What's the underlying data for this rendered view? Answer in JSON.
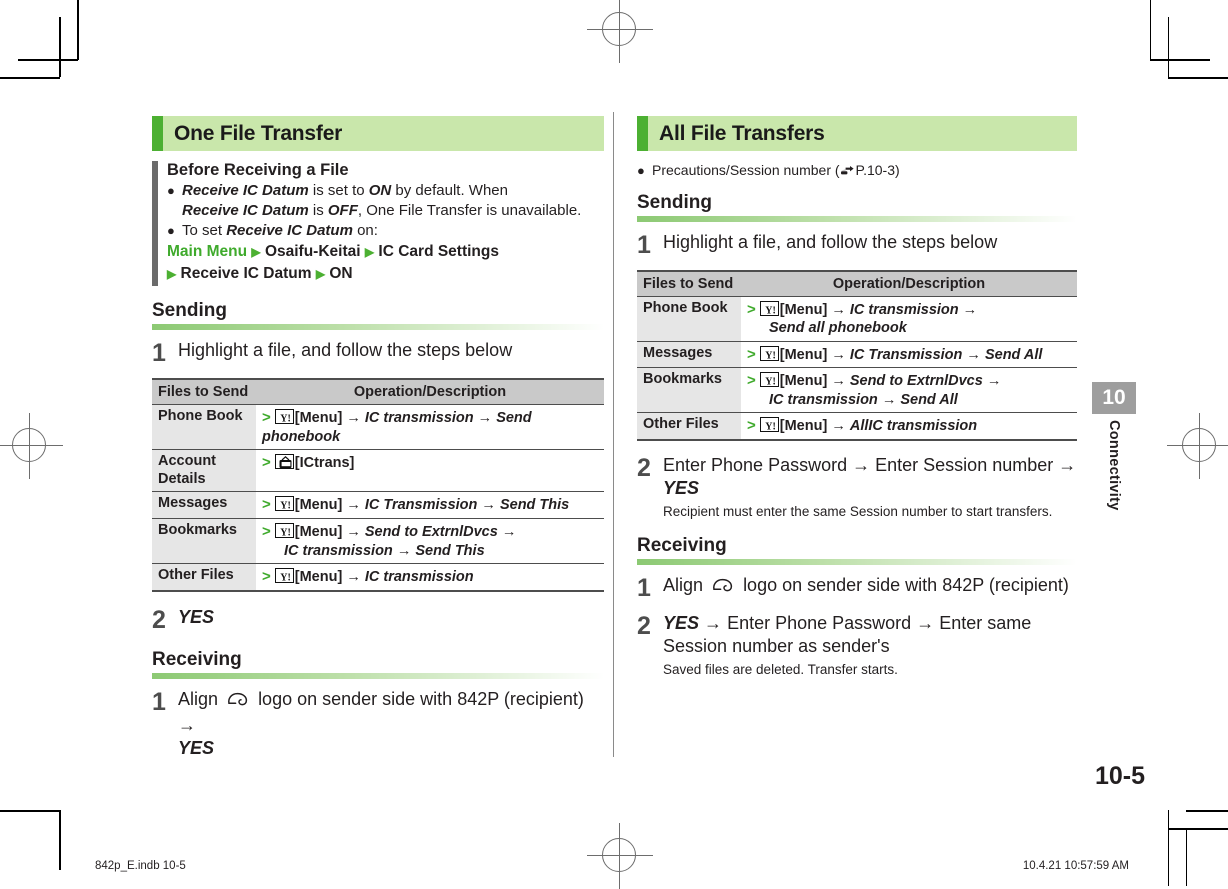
{
  "document": {
    "folio": "10-5",
    "chapter_tab": {
      "number": "10",
      "label": "Connectivity"
    },
    "footer": {
      "left": "842p_E.indb   10-5",
      "right": "10.4.21   10:57:59 AM"
    },
    "colors": {
      "accent_green": "#4cb032",
      "banner_bg": "#c9e7ab",
      "table_header_bg": "#c9c9c9",
      "row_key_bg": "#e6e6e6",
      "gray_rule": "#6b6b6b"
    }
  },
  "left_column": {
    "banner_title": "One File Transfer",
    "note": {
      "heading": "Before Receiving a File",
      "bullet1_a": "Receive IC Datum",
      "bullet1_b": " is set to ",
      "bullet1_c": "ON",
      "bullet1_d": " by default. When",
      "bullet1_line2_a": "Receive IC Datum",
      "bullet1_line2_b": " is ",
      "bullet1_line2_c": "OFF",
      "bullet1_line2_d": ", One File Transfer is unavailable.",
      "bullet2_a": "To set ",
      "bullet2_b": "Receive IC Datum",
      "bullet2_c": " on:",
      "path_main_menu": "Main Menu",
      "path_item1": "Osaifu-Keitai",
      "path_item2": "IC Card Settings",
      "path_item3": "Receive IC Datum",
      "path_item4": "ON"
    },
    "sending": {
      "heading": "Sending",
      "step1_num": "1",
      "step1_text": "Highlight a file, and follow the steps below",
      "step2_num": "2",
      "step2_text": "YES"
    },
    "table": {
      "header": {
        "col1": "Files to Send",
        "col2": "Operation/Description"
      },
      "rows": [
        {
          "key": "Phone Book",
          "icon": "yahoo-softkey-icon",
          "label": "[Menu]",
          "ops": [
            "IC transmission",
            "Send phonebook"
          ],
          "line2": ""
        },
        {
          "key": "Account Details",
          "icon": "tv-softkey-icon",
          "label": "[ICtrans]",
          "ops": [],
          "line2": ""
        },
        {
          "key": "Messages",
          "icon": "yahoo-softkey-icon",
          "label": "[Menu]",
          "ops": [
            "IC Transmission",
            "Send This"
          ],
          "line2": ""
        },
        {
          "key": "Bookmarks",
          "icon": "yahoo-softkey-icon",
          "label": "[Menu]",
          "ops": [
            "Send to ExtrnlDvcs"
          ],
          "line2_ops": [
            "IC transmission",
            "Send This"
          ]
        },
        {
          "key": "Other Files",
          "icon": "yahoo-softkey-icon",
          "label": "[Menu]",
          "ops": [
            "IC transmission"
          ],
          "line2": ""
        }
      ]
    },
    "receiving": {
      "heading": "Receiving",
      "step1_num": "1",
      "step1_a": "Align",
      "step1_b": "logo on sender side with 842P (recipient)",
      "step1_c": "YES"
    }
  },
  "right_column": {
    "banner_title": "All File Transfers",
    "precaution": {
      "text": "Precautions/Session number (",
      "ref": "P.10-3",
      "close": ")"
    },
    "sending": {
      "heading": "Sending",
      "step1_num": "1",
      "step1_text": "Highlight a file, and follow the steps below",
      "step2_num": "2",
      "step2_part1": "Enter Phone Password",
      "step2_part2": "Enter Session number",
      "step2_part3": "YES",
      "step2_sub": "Recipient must enter the same Session number to start transfers."
    },
    "table": {
      "header": {
        "col1": "Files to Send",
        "col2": "Operation/Description"
      },
      "rows": [
        {
          "key": "Phone Book",
          "icon": "yahoo-softkey-icon",
          "label": "[Menu]",
          "ops": [
            "IC transmission"
          ],
          "line2_ops": [
            "Send all phonebook"
          ]
        },
        {
          "key": "Messages",
          "icon": "yahoo-softkey-icon",
          "label": "[Menu]",
          "ops": [
            "IC Transmission",
            "Send All"
          ],
          "line2_ops": []
        },
        {
          "key": "Bookmarks",
          "icon": "yahoo-softkey-icon",
          "label": "[Menu]",
          "ops": [
            "Send to ExtrnlDvcs"
          ],
          "line2_ops": [
            "IC transmission",
            "Send All"
          ]
        },
        {
          "key": "Other Files",
          "icon": "yahoo-softkey-icon",
          "label": "[Menu]",
          "ops": [
            "AllIC transmission"
          ],
          "line2_ops": []
        }
      ]
    },
    "receiving": {
      "heading": "Receiving",
      "step1_num": "1",
      "step1_a": "Align",
      "step1_b": "logo on sender side with 842P (recipient)",
      "step2_num": "2",
      "step2_part1": "YES",
      "step2_part2": "Enter Phone Password",
      "step2_part3": "Enter same Session",
      "step2_line2": "number as sender's",
      "step2_sub": "Saved files are deleted. Transfer starts."
    }
  }
}
